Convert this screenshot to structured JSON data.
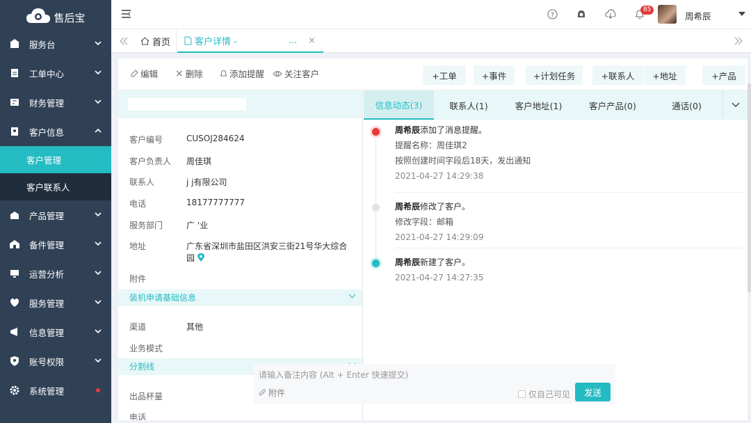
{
  "app": {
    "logo_text": "售后宝"
  },
  "sidebar": {
    "items": [
      {
        "label": "服务台",
        "icon": "grid-icon"
      },
      {
        "label": "工单中心",
        "icon": "ticket-icon"
      },
      {
        "label": "财务管理",
        "icon": "finance-icon"
      },
      {
        "label": "客户信息",
        "icon": "customer-icon",
        "expanded": true
      },
      {
        "label": "产品管理",
        "icon": "product-icon"
      },
      {
        "label": "备件管理",
        "icon": "parts-icon"
      },
      {
        "label": "运营分析",
        "icon": "analytics-icon"
      },
      {
        "label": "服务管理",
        "icon": "service-icon"
      },
      {
        "label": "信息管理",
        "icon": "message-icon"
      },
      {
        "label": "账号权限",
        "icon": "shield-icon"
      },
      {
        "label": "系统管理",
        "icon": "gear-icon"
      }
    ],
    "sub_items": [
      {
        "label": "客户管理",
        "active": true
      },
      {
        "label": "客户联系人",
        "active": false
      }
    ]
  },
  "topbar": {
    "notifications": "85",
    "user_name": "周希辰"
  },
  "tabs": {
    "home": "首页",
    "current": "客户详情 -",
    "ellipsis": "..."
  },
  "toolbar": {
    "edit": "编辑",
    "delete": "删除",
    "reminder": "添加提醒",
    "follow": "关注客户",
    "actions": [
      "+工单",
      "+事件",
      "+计划任务",
      "+联系人",
      "+地址",
      "+产品"
    ]
  },
  "customer": {
    "fields": [
      {
        "k": "客户编号",
        "v": "CUSOJ284624"
      },
      {
        "k": "客户负责人",
        "v": "周佳琪"
      },
      {
        "k": "联系人",
        "v": "j                    j有限公司"
      },
      {
        "k": "电话",
        "v": "18177777777"
      },
      {
        "k": "服务部门",
        "v": "广    '业"
      },
      {
        "k": "地址",
        "v": "广东省深圳市盐田区洪安三街21号华大综合",
        "v2": "园"
      },
      {
        "k": "附件",
        "v": ""
      }
    ],
    "section1": "装机申请基础信息",
    "section1_fields": [
      {
        "k": "渠道",
        "v": "其他"
      },
      {
        "k": "业务模式",
        "v": ""
      }
    ],
    "section2": "分割线",
    "section2_fields": [
      {
        "k": "出品杯量",
        "v": ""
      },
      {
        "k": "电话",
        "v": ""
      }
    ]
  },
  "rtabs": [
    "信息动态(3)",
    "联系人(1)",
    "客户地址(1)",
    "客户产品(0)",
    "通话(0)"
  ],
  "timeline": [
    {
      "actor": "周希辰",
      "action": "添加了消息提醒。",
      "lines": [
        "提醒名称：周佳琪2",
        "按照创建时间字段后18天，发出通知"
      ],
      "time": "2021-04-27 14:29:38",
      "color": "#e5393a"
    },
    {
      "actor": "周希辰",
      "action": "修改了客户。",
      "lines": [
        "修改字段：邮箱"
      ],
      "time": "2021-04-27 14:29:09",
      "color": "#e3e3e3"
    },
    {
      "actor": "周希辰",
      "action": "新建了客户。",
      "lines": [],
      "time": "2021-04-27 14:27:35",
      "color": "#24bbc3"
    }
  ],
  "note": {
    "placeholder": "请输入备注内容 (Alt + Enter 快速提交)",
    "attach": "附件",
    "private": "仅自己可见",
    "send": "发送"
  }
}
